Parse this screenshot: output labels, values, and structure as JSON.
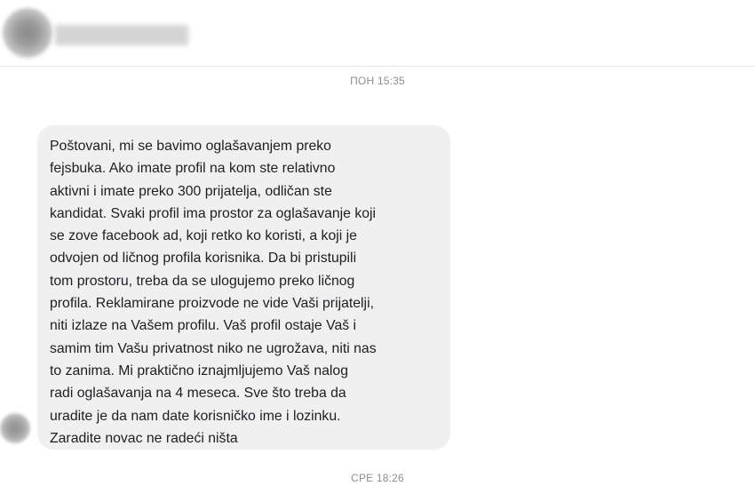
{
  "conversation": {
    "timestamp_top": "ПОН 15:35",
    "timestamp_bottom": "СРЕ 18:26",
    "message": {
      "text": "Poštovani, mi se bavimo oglašavanjem preko\nfejsbuka. Ako imate profil na kom ste relativno\naktivni i imate preko 300 prijatelja, odličan ste\nkandidat. Svaki profil ima prostor za oglašavanje koji\nse zove facebook ad, koji retko ko koristi, a koji je\nodvojen od ličnog profila korisnika. Da bi pristupili\ntom prostoru, treba da se ulogujemo preko ličnog\nprofila. Reklamirane proizvode ne vide Vaši prijatelji,\nniti izlaze na Vašem profilu. Vaš profil ostaje Vaš i\nsamim tim Vašu privatnost niko ne ugrožava, niti nas\nto zanima. Mi praktično iznajmljujemo Vaš nalog\nradi oglašavanja na 4 meseca. Sve što treba da\nuradite je da nam date korisničko ime i lozinku.\nZaradite novac ne radeći ništa"
    }
  },
  "colors": {
    "bubble_background": "#f0f0f0",
    "timestamp_text": "#8a8d91",
    "message_text": "#1c1e21",
    "divider": "#e4e6eb"
  }
}
